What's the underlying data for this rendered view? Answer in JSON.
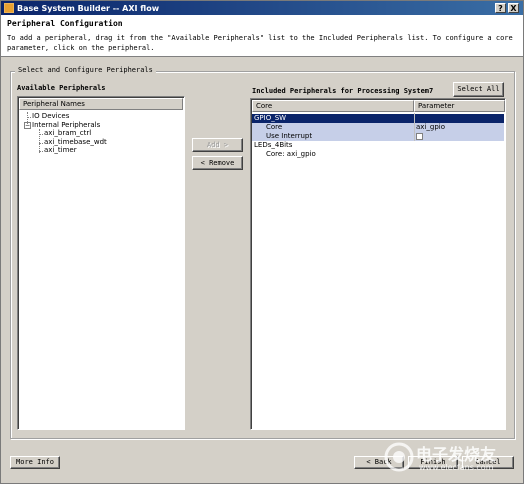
{
  "window": {
    "title": "Base System Builder -- AXI flow",
    "help_label": "?",
    "close_label": "X"
  },
  "header": {
    "title": "Peripheral Configuration",
    "description_line1": "To add a peripheral, drag it from the \"Available Peripherals\" list to the Included Peripherals list. To configure a core",
    "description_line2": "parameter, click on the peripheral."
  },
  "group": {
    "label": "Select and Configure Peripherals"
  },
  "available": {
    "label": "Available Peripherals",
    "column_header": "Peripheral Names",
    "tree": [
      {
        "label": "IO Devices",
        "level": 0,
        "expander": ""
      },
      {
        "label": "Internal Peripherals",
        "level": 0,
        "expander": "−"
      },
      {
        "label": "axi_bram_ctrl",
        "level": 1,
        "expander": ""
      },
      {
        "label": "axi_timebase_wdt",
        "level": 1,
        "expander": ""
      },
      {
        "label": "axi_timer",
        "level": 1,
        "expander": ""
      }
    ]
  },
  "buttons": {
    "add": "Add >",
    "remove": "< Remove",
    "select_all": "Select All",
    "more_info": "More Info",
    "back": "< Back",
    "finish": "Finish",
    "cancel": "Cancel"
  },
  "included": {
    "label": "Included Peripherals for Processing System7",
    "columns": [
      "Core",
      "Parameter"
    ],
    "rows": [
      {
        "core": "GPIO_SW",
        "param": "",
        "state": "selected",
        "indent": 0
      },
      {
        "core": "Core",
        "param": "axi_gpio",
        "state": "sel-light",
        "indent": 1
      },
      {
        "core": "Use Interrupt",
        "param": "",
        "state": "sel-light",
        "indent": 1,
        "checkbox": true
      },
      {
        "core": "LEDs_4Bits",
        "param": "",
        "state": "",
        "indent": 0
      },
      {
        "core": "Core: axi_gpio",
        "param": "",
        "state": "",
        "indent": 1
      }
    ]
  },
  "watermark": {
    "text": "电子发烧友",
    "url": "www.elecfans.com"
  }
}
